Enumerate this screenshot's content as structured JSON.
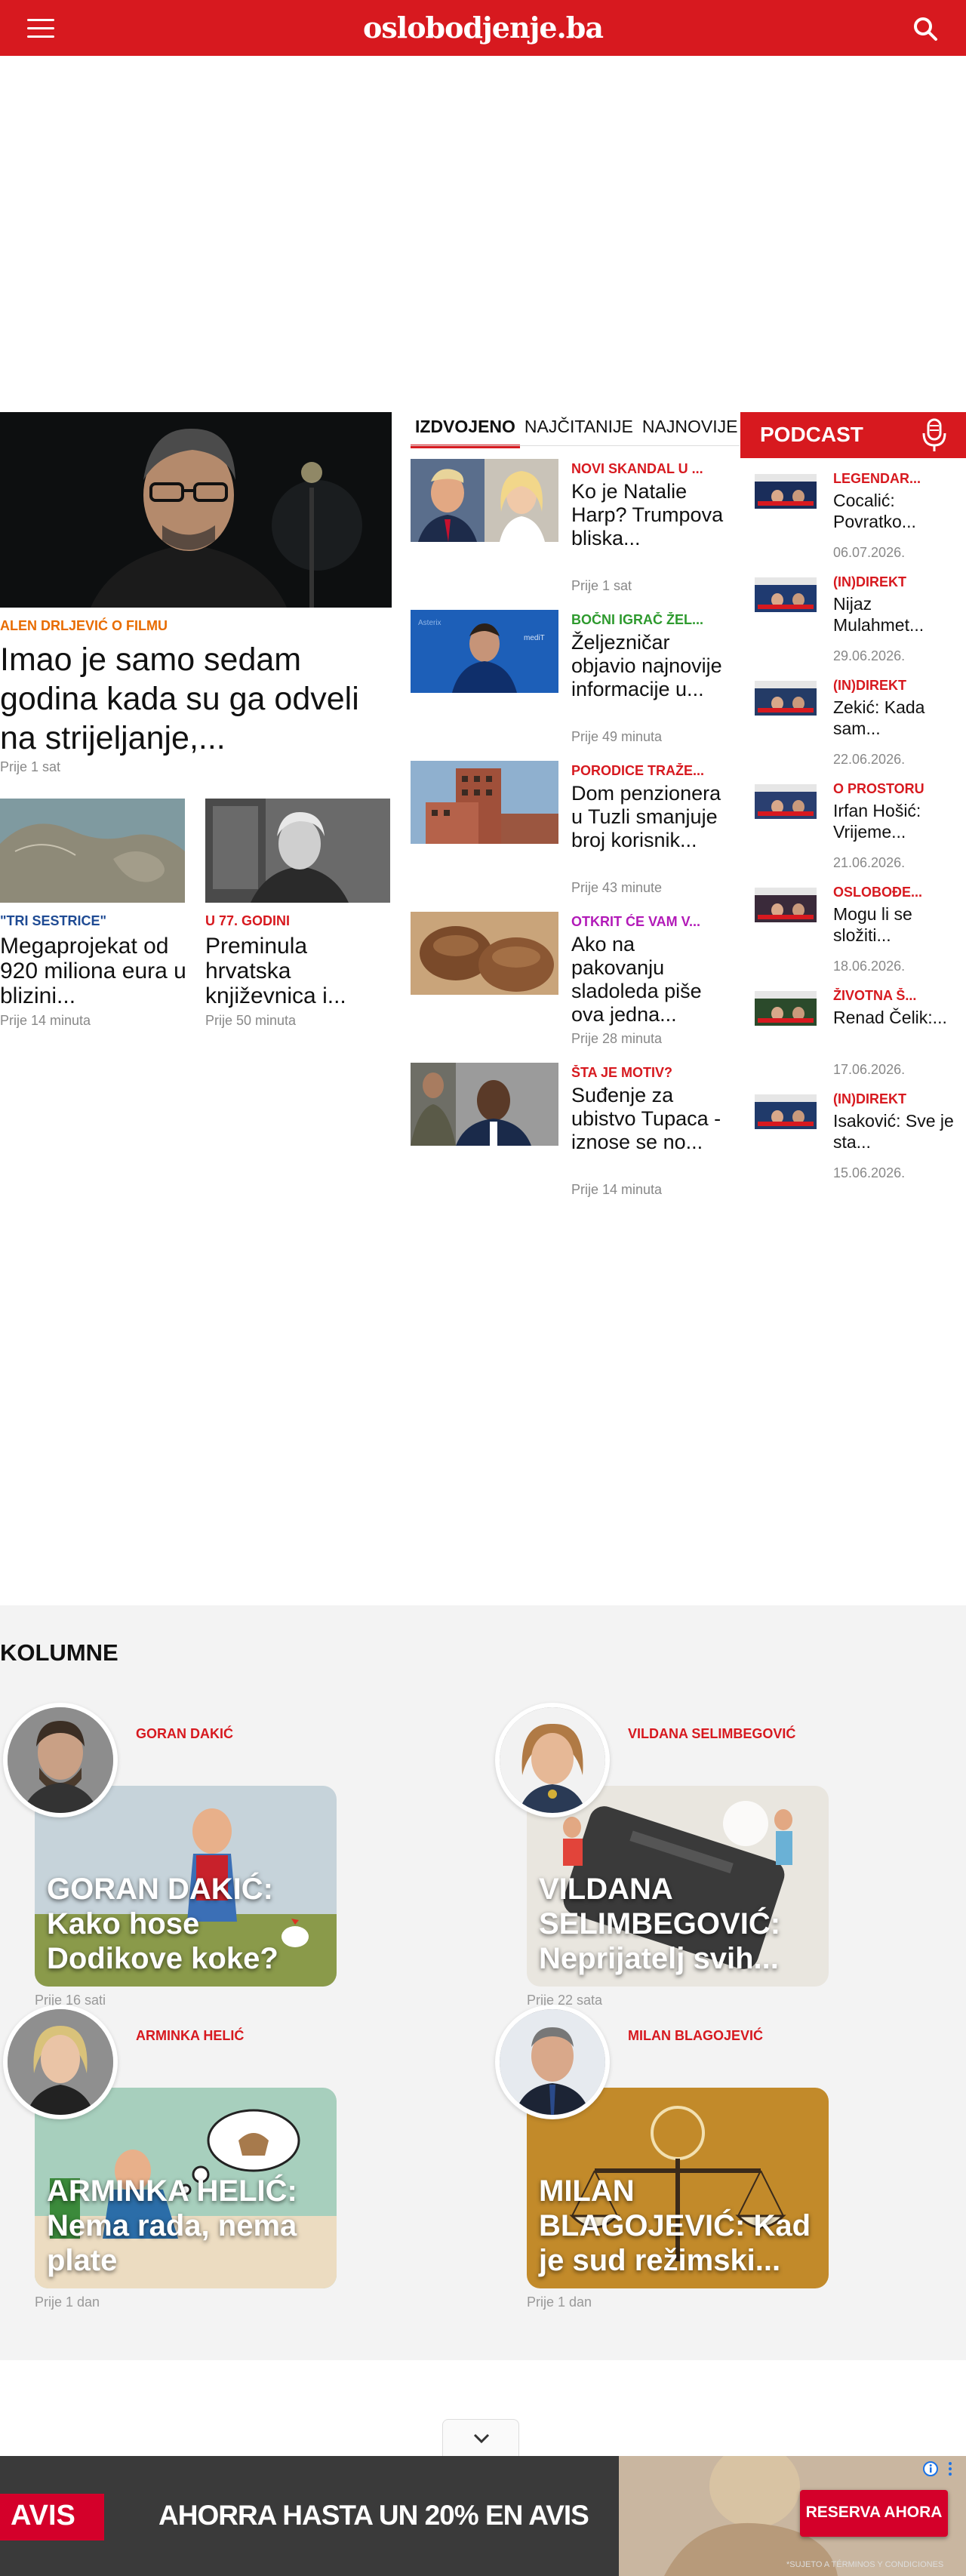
{
  "header": {
    "logo": "oslobodjenje.ba"
  },
  "lead": {
    "kicker": "ALEN DRLJEVIĆ O FILMU",
    "title": "Imao je samo sedam godina kada su ga odveli na strijeljanje,...",
    "time": "Prije 1 sat"
  },
  "small_articles": [
    {
      "kicker": "\"TRI SESTRICE\"",
      "title": "Megaprojekat od 920 miliona eura u blizini...",
      "time": "Prije 14 minuta"
    },
    {
      "kicker": "U 77. GODINI",
      "title": "Preminula hrvatska književnica i...",
      "time": "Prije 50 minuta"
    }
  ],
  "tabs": [
    "IZDVOJENO",
    "NAJČITANIJE",
    "NAJNOVIJE"
  ],
  "featured": [
    {
      "kicker": "NOVI SKANDAL U ...",
      "title": "Ko je Natalie Harp? Trumpova bliska...",
      "time": "Prije 1 sat"
    },
    {
      "kicker": "BOČNI IGRAČ ŽEL...",
      "title": "Željezničar objavio najnovije informacije u...",
      "time": "Prije 49 minuta"
    },
    {
      "kicker": "PORODICE TRAŽE...",
      "title": "Dom penzionera u Tuzli smanjuje broj korisnik...",
      "time": "Prije 43 minute"
    },
    {
      "kicker": "OTKRIT ĆE VAM V...",
      "title": "Ako na pakovanju sladoleda piše ova jedna...",
      "time": "Prije 28 minuta"
    },
    {
      "kicker": "ŠTA JE MOTIV?",
      "title": "Suđenje za ubistvo Tupaca - iznose se no...",
      "time": "Prije 14 minuta"
    }
  ],
  "podcast": {
    "heading": "PODCAST",
    "items": [
      {
        "kicker": "LEGENDAR...",
        "title": "Cocalić: Povratko...",
        "date": "06.07.2026."
      },
      {
        "kicker": "(IN)DIREKT",
        "title": "Nijaz Mulahmet...",
        "date": "29.06.2026."
      },
      {
        "kicker": "(IN)DIREKT",
        "title": "Zekić: Kada sam...",
        "date": "22.06.2026."
      },
      {
        "kicker": "O PROSTORU",
        "title": "Irfan Hošić: Vrijeme...",
        "date": "21.06.2026."
      },
      {
        "kicker": "OSLOBOĐE...",
        "title": "Mogu li se složiti...",
        "date": "18.06.2026."
      },
      {
        "kicker": "ŽIVOTNA Š...",
        "title": "Renad Čelik:...",
        "date": "17.06.2026."
      },
      {
        "kicker": "(IN)DIREKT",
        "title": "Isaković: Sve je sta...",
        "date": "15.06.2026."
      }
    ]
  },
  "kolumne": {
    "heading": "KOLUMNE",
    "items": [
      {
        "author": "GORAN DAKIĆ",
        "title": "GORAN DAKIĆ: Kako hose Dodikove koke?",
        "time": "Prije 16 sati"
      },
      {
        "author": "VILDANA SELIMBEGOVIĆ",
        "title": "VILDANA SELIMBEGOVIĆ: Neprijatelj svih...",
        "time": "Prije 22 sata"
      },
      {
        "author": "ARMINKA HELIĆ",
        "title": "ARMINKA HELIĆ: Nema rada, nema plate",
        "time": "Prije 1 dan"
      },
      {
        "author": "MILAN BLAGOJEVIĆ",
        "title": "MILAN BLAGOJEVIĆ: Kad je sud režimski...",
        "time": "Prije 1 dan"
      }
    ]
  },
  "ad": {
    "brand": "AVIS",
    "headline": "AHORRA HASTA UN 20% EN AVIS",
    "cta": "RESERVA AHORA",
    "fine_print": "*SUJETO A TÉRMINOS Y CONDICIONES"
  },
  "colors": {
    "brand_red": "#d7191f",
    "avis_red": "#d4002a"
  },
  "icons": [
    "hamburger-menu-icon",
    "search-icon",
    "microphone-icon",
    "chevron-down-icon",
    "ad-info-icon",
    "ad-close-icon"
  ]
}
